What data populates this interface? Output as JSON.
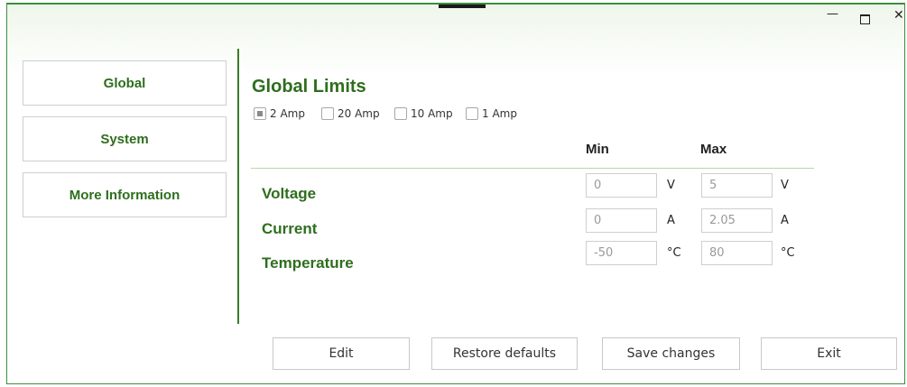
{
  "window": {
    "controls": [
      "minimize-icon",
      "maximize-icon",
      "close-icon"
    ]
  },
  "nav": {
    "items": [
      {
        "label": "Global"
      },
      {
        "label": "System"
      },
      {
        "label": "More Information"
      }
    ]
  },
  "main": {
    "heading": "Global Limits",
    "ranges": [
      {
        "label": "2 Amp",
        "checked": true
      },
      {
        "label": "20 Amp",
        "checked": false
      },
      {
        "label": "10 Amp",
        "checked": false
      },
      {
        "label": "1 Amp",
        "checked": false
      }
    ],
    "columns": {
      "min": "Min",
      "max": "Max"
    },
    "rows": [
      {
        "label": "Voltage",
        "min": "0",
        "max": "5",
        "unit": "V"
      },
      {
        "label": "Current",
        "min": "0",
        "max": "2.05",
        "unit": "A"
      },
      {
        "label": "Temperature",
        "min": "-50",
        "max": "80",
        "unit": "°C"
      }
    ]
  },
  "actions": {
    "edit": "Edit",
    "restore": "Restore defaults",
    "save": "Save changes",
    "exit": "Exit"
  },
  "colors": {
    "accent": "#2e6e1e",
    "border": "#3b8f3b"
  }
}
